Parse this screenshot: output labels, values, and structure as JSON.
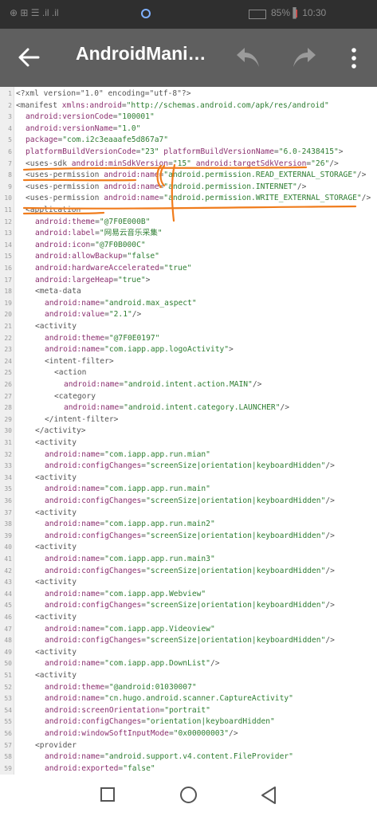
{
  "status_bar": {
    "left_text": "⊕ ⊞ ☰  .il .il",
    "right_text": "85%  ▌ 10:30"
  },
  "app_bar": {
    "title": "AndroidMani…",
    "back_icon": "arrow-left-icon",
    "undo_icon": "undo-icon",
    "redo_icon": "redo-icon",
    "more_icon": "more-vert-icon"
  },
  "editor": {
    "lines": [
      {
        "n": "1",
        "indent": 0,
        "segs": [
          [
            "p",
            "<?xml version=\"1.0\" encoding=\"utf-8\"?>"
          ]
        ]
      },
      {
        "n": "2",
        "indent": 0,
        "segs": [
          [
            "p",
            "<manifest "
          ],
          [
            "a",
            "xmlns:android"
          ],
          [
            "p",
            "="
          ],
          [
            "v",
            "\"http://schemas.android.com/apk/res/android\""
          ]
        ]
      },
      {
        "n": "3",
        "indent": 1,
        "segs": [
          [
            "a",
            "android:versionCode"
          ],
          [
            "p",
            "="
          ],
          [
            "v",
            "\"100001\""
          ]
        ]
      },
      {
        "n": "4",
        "indent": 1,
        "segs": [
          [
            "a",
            "android:versionName"
          ],
          [
            "p",
            "="
          ],
          [
            "v",
            "\"1.0\""
          ]
        ]
      },
      {
        "n": "5",
        "indent": 1,
        "segs": [
          [
            "a",
            "package"
          ],
          [
            "p",
            "="
          ],
          [
            "v",
            "\"com.i2c3eaaafe5d867a7\""
          ]
        ]
      },
      {
        "n": "6",
        "indent": 1,
        "segs": [
          [
            "a",
            "platformBuildVersionCode"
          ],
          [
            "p",
            "="
          ],
          [
            "v",
            "\"23\""
          ],
          [
            "p",
            " "
          ],
          [
            "a",
            "platformBuildVersionName"
          ],
          [
            "p",
            "="
          ],
          [
            "v",
            "\"6.0-2438415\""
          ],
          [
            "p",
            ">"
          ]
        ]
      },
      {
        "n": "7",
        "indent": 1,
        "segs": [
          [
            "p",
            "<uses-sdk "
          ],
          [
            "a",
            "android:minSdkVersion"
          ],
          [
            "p",
            "="
          ],
          [
            "v",
            "\"15\""
          ],
          [
            "p",
            " "
          ],
          [
            "a",
            "android:targetSdkVersion"
          ],
          [
            "p",
            "="
          ],
          [
            "v",
            "\"26\""
          ],
          [
            "p",
            "/>"
          ]
        ]
      },
      {
        "n": "8",
        "indent": 1,
        "segs": [
          [
            "p",
            "<uses-permission "
          ],
          [
            "a",
            "android:name"
          ],
          [
            "p",
            "="
          ],
          [
            "v",
            "\"android.permission.READ_EXTERNAL_STORAGE\""
          ],
          [
            "p",
            "/>"
          ]
        ]
      },
      {
        "n": "9",
        "indent": 1,
        "segs": [
          [
            "p",
            "<uses-permission "
          ],
          [
            "a",
            "android:name"
          ],
          [
            "p",
            "="
          ],
          [
            "v",
            "\"android.permission.INTERNET\""
          ],
          [
            "p",
            "/>"
          ]
        ]
      },
      {
        "n": "10",
        "indent": 1,
        "segs": [
          [
            "p",
            "<uses-permission "
          ],
          [
            "a",
            "android:name"
          ],
          [
            "p",
            "="
          ],
          [
            "v",
            "\"android.permission.WRITE_EXTERNAL_STORAGE\""
          ],
          [
            "p",
            "/>"
          ]
        ]
      },
      {
        "n": "11",
        "indent": 1,
        "segs": [
          [
            "p",
            "<application"
          ]
        ]
      },
      {
        "n": "12",
        "indent": 2,
        "segs": [
          [
            "a",
            "android:theme"
          ],
          [
            "p",
            "="
          ],
          [
            "v",
            "\"@7F0E000B\""
          ]
        ]
      },
      {
        "n": "13",
        "indent": 2,
        "segs": [
          [
            "a",
            "android:label"
          ],
          [
            "p",
            "="
          ],
          [
            "v",
            "\"网易云音乐采集\""
          ]
        ]
      },
      {
        "n": "14",
        "indent": 2,
        "segs": [
          [
            "a",
            "android:icon"
          ],
          [
            "p",
            "="
          ],
          [
            "v",
            "\"@7F0B000C\""
          ]
        ]
      },
      {
        "n": "15",
        "indent": 2,
        "segs": [
          [
            "a",
            "android:allowBackup"
          ],
          [
            "p",
            "="
          ],
          [
            "v",
            "\"false\""
          ]
        ]
      },
      {
        "n": "16",
        "indent": 2,
        "segs": [
          [
            "a",
            "android:hardwareAccelerated"
          ],
          [
            "p",
            "="
          ],
          [
            "v",
            "\"true\""
          ]
        ]
      },
      {
        "n": "17",
        "indent": 2,
        "segs": [
          [
            "a",
            "android:largeHeap"
          ],
          [
            "p",
            "="
          ],
          [
            "v",
            "\"true\""
          ],
          [
            "p",
            ">"
          ]
        ]
      },
      {
        "n": "18",
        "indent": 2,
        "segs": [
          [
            "p",
            "<meta-data"
          ]
        ]
      },
      {
        "n": "19",
        "indent": 3,
        "segs": [
          [
            "a",
            "android:name"
          ],
          [
            "p",
            "="
          ],
          [
            "v",
            "\"android.max_aspect\""
          ]
        ]
      },
      {
        "n": "20",
        "indent": 3,
        "segs": [
          [
            "a",
            "android:value"
          ],
          [
            "p",
            "="
          ],
          [
            "v",
            "\"2.1\""
          ],
          [
            "p",
            "/>"
          ]
        ]
      },
      {
        "n": "21",
        "indent": 2,
        "segs": [
          [
            "p",
            "<activity"
          ]
        ]
      },
      {
        "n": "22",
        "indent": 3,
        "segs": [
          [
            "a",
            "android:theme"
          ],
          [
            "p",
            "="
          ],
          [
            "v",
            "\"@7F0E0197\""
          ]
        ]
      },
      {
        "n": "23",
        "indent": 3,
        "segs": [
          [
            "a",
            "android:name"
          ],
          [
            "p",
            "="
          ],
          [
            "v",
            "\"com.iapp.app.logoActivity\""
          ],
          [
            "p",
            ">"
          ]
        ]
      },
      {
        "n": "24",
        "indent": 3,
        "segs": [
          [
            "p",
            "<intent-filter>"
          ]
        ]
      },
      {
        "n": "25",
        "indent": 4,
        "segs": [
          [
            "p",
            "<action"
          ]
        ]
      },
      {
        "n": "26",
        "indent": 5,
        "segs": [
          [
            "a",
            "android:name"
          ],
          [
            "p",
            "="
          ],
          [
            "v",
            "\"android.intent.action.MAIN\""
          ],
          [
            "p",
            "/>"
          ]
        ]
      },
      {
        "n": "27",
        "indent": 4,
        "segs": [
          [
            "p",
            "<category"
          ]
        ]
      },
      {
        "n": "28",
        "indent": 5,
        "segs": [
          [
            "a",
            "android:name"
          ],
          [
            "p",
            "="
          ],
          [
            "v",
            "\"android.intent.category.LAUNCHER\""
          ],
          [
            "p",
            "/>"
          ]
        ]
      },
      {
        "n": "29",
        "indent": 3,
        "segs": [
          [
            "p",
            "</intent-filter>"
          ]
        ]
      },
      {
        "n": "30",
        "indent": 2,
        "segs": [
          [
            "p",
            "</activity>"
          ]
        ]
      },
      {
        "n": "31",
        "indent": 2,
        "segs": [
          [
            "p",
            "<activity"
          ]
        ]
      },
      {
        "n": "32",
        "indent": 3,
        "segs": [
          [
            "a",
            "android:name"
          ],
          [
            "p",
            "="
          ],
          [
            "v",
            "\"com.iapp.app.run.mian\""
          ]
        ]
      },
      {
        "n": "33",
        "indent": 3,
        "segs": [
          [
            "a",
            "android:configChanges"
          ],
          [
            "p",
            "="
          ],
          [
            "v",
            "\"screenSize|orientation|keyboardHidden\""
          ],
          [
            "p",
            "/>"
          ]
        ]
      },
      {
        "n": "34",
        "indent": 2,
        "segs": [
          [
            "p",
            "<activity"
          ]
        ]
      },
      {
        "n": "35",
        "indent": 3,
        "segs": [
          [
            "a",
            "android:name"
          ],
          [
            "p",
            "="
          ],
          [
            "v",
            "\"com.iapp.app.run.main\""
          ]
        ]
      },
      {
        "n": "36",
        "indent": 3,
        "segs": [
          [
            "a",
            "android:configChanges"
          ],
          [
            "p",
            "="
          ],
          [
            "v",
            "\"screenSize|orientation|keyboardHidden\""
          ],
          [
            "p",
            "/>"
          ]
        ]
      },
      {
        "n": "37",
        "indent": 2,
        "segs": [
          [
            "p",
            "<activity"
          ]
        ]
      },
      {
        "n": "38",
        "indent": 3,
        "segs": [
          [
            "a",
            "android:name"
          ],
          [
            "p",
            "="
          ],
          [
            "v",
            "\"com.iapp.app.run.main2\""
          ]
        ]
      },
      {
        "n": "39",
        "indent": 3,
        "segs": [
          [
            "a",
            "android:configChanges"
          ],
          [
            "p",
            "="
          ],
          [
            "v",
            "\"screenSize|orientation|keyboardHidden\""
          ],
          [
            "p",
            "/>"
          ]
        ]
      },
      {
        "n": "40",
        "indent": 2,
        "segs": [
          [
            "p",
            "<activity"
          ]
        ]
      },
      {
        "n": "41",
        "indent": 3,
        "segs": [
          [
            "a",
            "android:name"
          ],
          [
            "p",
            "="
          ],
          [
            "v",
            "\"com.iapp.app.run.main3\""
          ]
        ]
      },
      {
        "n": "42",
        "indent": 3,
        "segs": [
          [
            "a",
            "android:configChanges"
          ],
          [
            "p",
            "="
          ],
          [
            "v",
            "\"screenSize|orientation|keyboardHidden\""
          ],
          [
            "p",
            "/>"
          ]
        ]
      },
      {
        "n": "43",
        "indent": 2,
        "segs": [
          [
            "p",
            "<activity"
          ]
        ]
      },
      {
        "n": "44",
        "indent": 3,
        "segs": [
          [
            "a",
            "android:name"
          ],
          [
            "p",
            "="
          ],
          [
            "v",
            "\"com.iapp.app.Webview\""
          ]
        ]
      },
      {
        "n": "45",
        "indent": 3,
        "segs": [
          [
            "a",
            "android:configChanges"
          ],
          [
            "p",
            "="
          ],
          [
            "v",
            "\"screenSize|orientation|keyboardHidden\""
          ],
          [
            "p",
            "/>"
          ]
        ]
      },
      {
        "n": "46",
        "indent": 2,
        "segs": [
          [
            "p",
            "<activity"
          ]
        ]
      },
      {
        "n": "47",
        "indent": 3,
        "segs": [
          [
            "a",
            "android:name"
          ],
          [
            "p",
            "="
          ],
          [
            "v",
            "\"com.iapp.app.Videoview\""
          ]
        ]
      },
      {
        "n": "48",
        "indent": 3,
        "segs": [
          [
            "a",
            "android:configChanges"
          ],
          [
            "p",
            "="
          ],
          [
            "v",
            "\"screenSize|orientation|keyboardHidden\""
          ],
          [
            "p",
            "/>"
          ]
        ]
      },
      {
        "n": "49",
        "indent": 2,
        "segs": [
          [
            "p",
            "<activity"
          ]
        ]
      },
      {
        "n": "50",
        "indent": 3,
        "segs": [
          [
            "a",
            "android:name"
          ],
          [
            "p",
            "="
          ],
          [
            "v",
            "\"com.iapp.app.DownList\""
          ],
          [
            "p",
            "/>"
          ]
        ]
      },
      {
        "n": "51",
        "indent": 2,
        "segs": [
          [
            "p",
            "<activity"
          ]
        ]
      },
      {
        "n": "52",
        "indent": 3,
        "segs": [
          [
            "a",
            "android:theme"
          ],
          [
            "p",
            "="
          ],
          [
            "v",
            "\"@android:01030007\""
          ]
        ]
      },
      {
        "n": "53",
        "indent": 3,
        "segs": [
          [
            "a",
            "android:name"
          ],
          [
            "p",
            "="
          ],
          [
            "v",
            "\"cn.hugo.android.scanner.CaptureActivity\""
          ]
        ]
      },
      {
        "n": "54",
        "indent": 3,
        "segs": [
          [
            "a",
            "android:screenOrientation"
          ],
          [
            "p",
            "="
          ],
          [
            "v",
            "\"portrait\""
          ]
        ]
      },
      {
        "n": "55",
        "indent": 3,
        "segs": [
          [
            "a",
            "android:configChanges"
          ],
          [
            "p",
            "="
          ],
          [
            "v",
            "\"orientation|keyboardHidden\""
          ]
        ]
      },
      {
        "n": "56",
        "indent": 3,
        "segs": [
          [
            "a",
            "android:windowSoftInputMode"
          ],
          [
            "p",
            "="
          ],
          [
            "v",
            "\"0x00000003\""
          ],
          [
            "p",
            "/>"
          ]
        ]
      },
      {
        "n": "57",
        "indent": 2,
        "segs": [
          [
            "p",
            "<provider"
          ]
        ]
      },
      {
        "n": "58",
        "indent": 3,
        "segs": [
          [
            "a",
            "android:name"
          ],
          [
            "p",
            "="
          ],
          [
            "v",
            "\"android.support.v4.content.FileProvider\""
          ]
        ]
      },
      {
        "n": "59",
        "indent": 3,
        "segs": [
          [
            "a",
            "android:exported"
          ],
          [
            "p",
            "="
          ],
          [
            "v",
            "\"false\""
          ]
        ]
      }
    ]
  },
  "annotation": {
    "color": "#f07c1c"
  },
  "nav_bar": {
    "recents_icon": "square-recents-icon",
    "home_icon": "circle-home-icon",
    "back_icon": "triangle-back-icon"
  }
}
